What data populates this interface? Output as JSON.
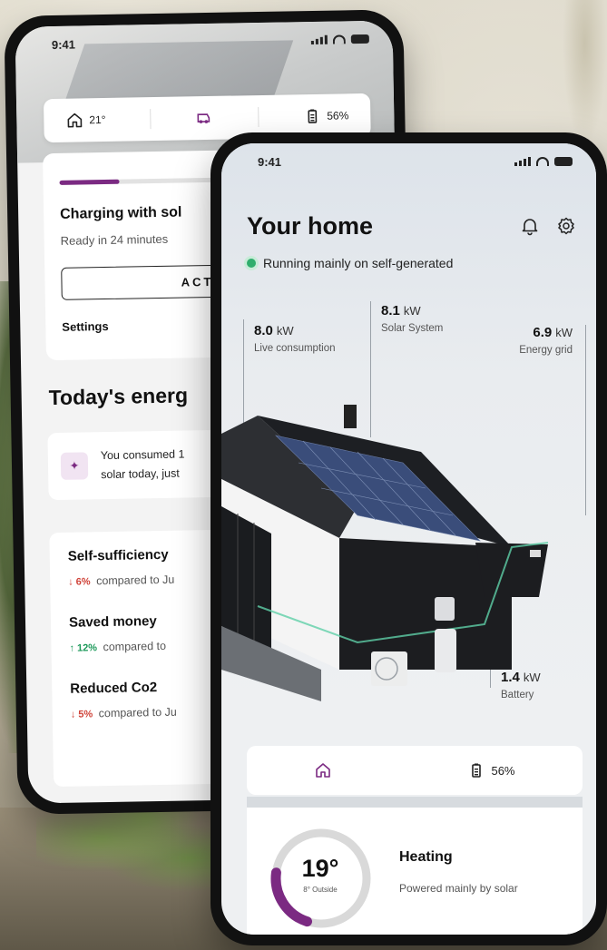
{
  "colors": {
    "accent": "#7b2a82",
    "positive": "#1e9a5b",
    "negative": "#d0443a",
    "status_dot": "#2fae6d"
  },
  "back_phone": {
    "status_time": "9:41",
    "pill": {
      "temperature": "21°",
      "battery": "56%"
    },
    "charging": {
      "progress": 0.22,
      "title": "Charging with sol",
      "subtitle": "Ready in 24 minutes",
      "action_button": "ACT",
      "settings": "Settings"
    },
    "today_heading": "Today's energ",
    "consumed": {
      "line1": "You consumed 1",
      "line2": "solar today, just"
    },
    "stats": [
      {
        "title": "Self-sufficiency",
        "delta": "6%",
        "direction": "down",
        "text": "compared to Ju"
      },
      {
        "title": "Saved money",
        "delta": "12%",
        "direction": "up",
        "text": "compared to"
      },
      {
        "title": "Reduced Co2",
        "delta": "5%",
        "direction": "down",
        "text": "compared to Ju"
      }
    ]
  },
  "front_phone": {
    "status_time": "9:41",
    "title": "Your home",
    "status_text": "Running mainly on self-generated",
    "metrics": {
      "live": {
        "value": "8.0",
        "unit": "kW",
        "label": "Live consumption"
      },
      "solar": {
        "value": "8.1",
        "unit": "kW",
        "label": "Solar System"
      },
      "grid": {
        "value": "6.9",
        "unit": "kW",
        "label": "Energy grid"
      },
      "battery": {
        "value": "1.4",
        "unit": "kW",
        "label": "Battery"
      }
    },
    "pill": {
      "battery": "56%"
    },
    "heating": {
      "temperature": "19°",
      "outside": "8° Outside",
      "title": "Heating",
      "subtitle": "Powered mainly by solar",
      "gauge_fraction": 0.4
    }
  }
}
